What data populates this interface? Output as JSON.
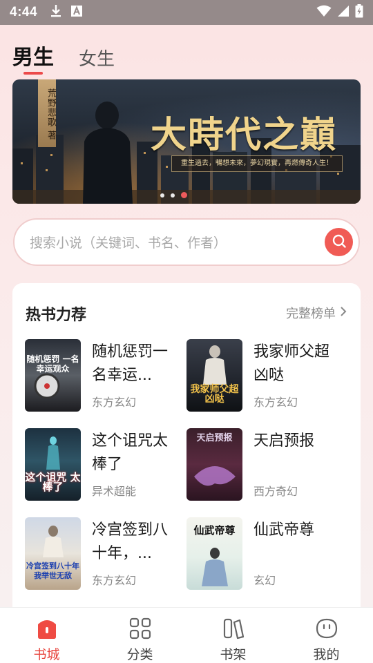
{
  "status_bar": {
    "time": "4:44",
    "left_icons": [
      "download-icon",
      "font-a-icon"
    ],
    "right_icons": [
      "wifi-icon",
      "signal-icon",
      "battery-charging-icon"
    ]
  },
  "gender_tabs": [
    {
      "label": "男生",
      "active": true
    },
    {
      "label": "女生",
      "active": false
    }
  ],
  "banner": {
    "title": "大時代之巔",
    "author_tag": "荒野悲歌 著",
    "tagline": "重生過去，暢想未來，夢幻現實，再燃傳奇人生！",
    "slide_count": 3,
    "active_slide": 3
  },
  "search": {
    "placeholder": "搜索小说（关键词、书名、作者）",
    "button_icon": "search-icon"
  },
  "hot_section": {
    "title": "热书力荐",
    "more_label": "完整榜单",
    "books": [
      {
        "title": "随机惩罚一名幸运...",
        "genre": "东方玄幻",
        "cover_text": "随机惩罚 一名幸运观众"
      },
      {
        "title": "我家师父超凶哒",
        "genre": "东方玄幻",
        "cover_text": "我家师父超凶哒"
      },
      {
        "title": "这个诅咒太棒了",
        "genre": "异术超能",
        "cover_text": "这个诅咒 太棒了"
      },
      {
        "title": "天启预报",
        "genre": "西方奇幻",
        "cover_text": "天启预报"
      },
      {
        "title": "冷宫签到八十年，...",
        "genre": "东方玄幻",
        "cover_text": "冷宫签到八十年 我举世无敌"
      },
      {
        "title": "仙武帝尊",
        "genre": "玄幻",
        "cover_text": "仙武帝尊"
      }
    ]
  },
  "bottom_nav": [
    {
      "label": "书城",
      "icon": "bookstore-icon",
      "active": true
    },
    {
      "label": "分类",
      "icon": "category-grid-icon",
      "active": false
    },
    {
      "label": "书架",
      "icon": "bookshelf-icon",
      "active": false
    },
    {
      "label": "我的",
      "icon": "profile-face-icon",
      "active": false
    }
  ],
  "colors": {
    "accent": "#e8463f",
    "background": "#fbe6e6",
    "status_bar": "#958a8a"
  }
}
